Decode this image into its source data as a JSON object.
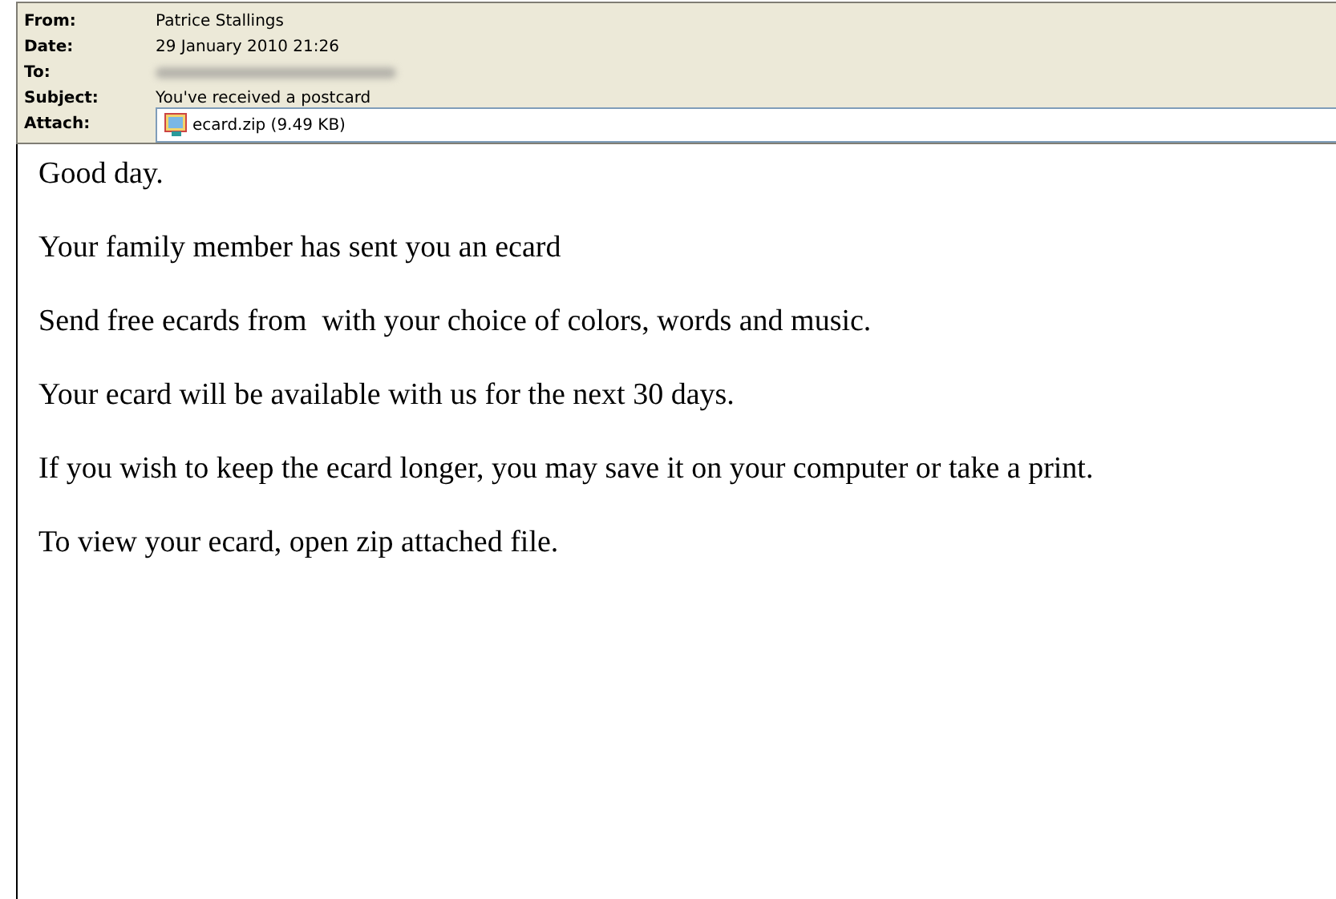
{
  "header": {
    "fields": [
      {
        "kind": "text",
        "label": "From:",
        "value": "Patrice Stallings"
      },
      {
        "kind": "text",
        "label": "Date:",
        "value": "29 January 2010 21:26"
      },
      {
        "kind": "blurred",
        "label": "To:"
      },
      {
        "kind": "text",
        "label": "Subject:",
        "value": "You've received a postcard"
      },
      {
        "kind": "attachment",
        "label": "Attach:",
        "value": "ecard.zip (9.49 KB)"
      }
    ]
  },
  "body": {
    "paragraphs": [
      "Good day.",
      "Your family member has sent you an ecard",
      "Send free ecards from  with your choice of colors, words and music.",
      "Your ecard will be available with us for the next 30 days.",
      "If you wish to keep the ecard longer, you may save it on your computer or take a print.",
      "To view your ecard, open zip attached file."
    ]
  }
}
